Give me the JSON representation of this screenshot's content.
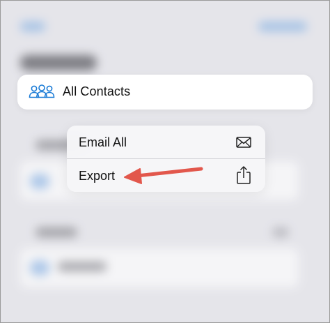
{
  "contacts_pill": {
    "label": "All Contacts",
    "icon": "people-icon"
  },
  "menu": {
    "items": [
      {
        "label": "Email All",
        "icon": "envelope-icon"
      },
      {
        "label": "Export",
        "icon": "share-icon"
      }
    ]
  },
  "annotation": {
    "arrow_color": "#e2574c",
    "icon": "arrow-left-icon"
  },
  "colors": {
    "accent": "#1a7bd6",
    "menu_bg": "#f6f6f8",
    "pill_bg": "#ffffff"
  }
}
